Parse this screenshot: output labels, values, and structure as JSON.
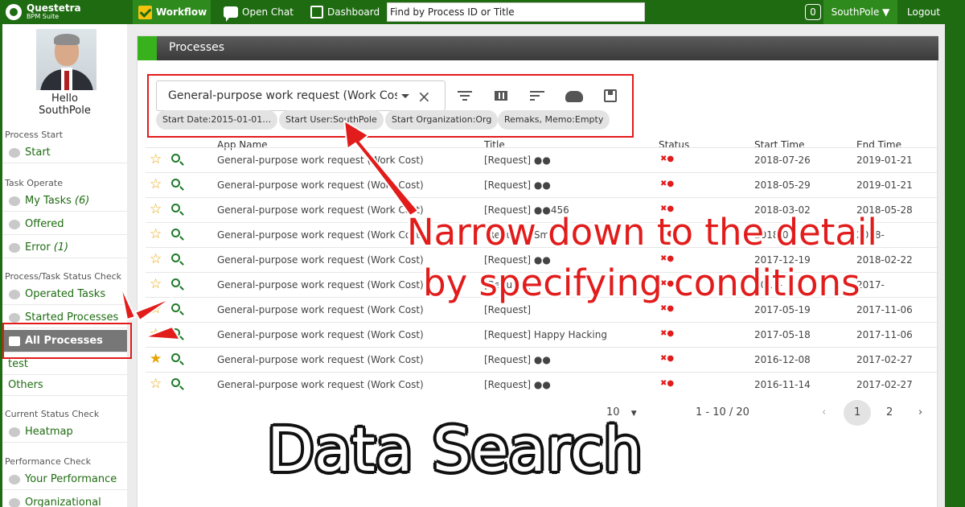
{
  "brand": {
    "name": "Questetra",
    "sub": "BPM Suite"
  },
  "topbar": {
    "workflow_label": "Workflow",
    "chat_label": "Open Chat",
    "dashboard_label": "Dashboard",
    "search_placeholder": "Find by Process ID or Title",
    "notification_count": "0",
    "user_label": "SouthPole ▼",
    "logout_label": "Logout"
  },
  "sidebar": {
    "hello": "Hello",
    "user": "SouthPole",
    "section_process_start": "Process Start",
    "start": "Start",
    "section_task_operate": "Task Operate",
    "my_tasks": "My Tasks",
    "my_tasks_count": "(6)",
    "offered": "Offered",
    "error": "Error",
    "error_count": "(1)",
    "section_status_check": "Process/Task Status Check",
    "operated_tasks": "Operated Tasks",
    "started_processes": "Started Processes",
    "all_processes": "All Processes",
    "test": "test",
    "others": "Others",
    "section_current_status": "Current Status Check",
    "heatmap": "Heatmap",
    "section_performance": "Performance Check",
    "your_performance": "Your Performance",
    "organizational": "Organizational"
  },
  "panel": {
    "title": "Processes",
    "filter_select": "General-purpose work request (Work Cost)",
    "chips": [
      "Start Date:2015-01-01…",
      "Start User:SouthPole",
      "Start Organization:Org",
      "Remaks, Memo:Empty"
    ]
  },
  "table": {
    "headers": [
      "App Name",
      "Title",
      "Status",
      "Start Time",
      "End Time"
    ],
    "rows": [
      {
        "app": "General-purpose work request (Work Cost)",
        "title": "[Request] ●●",
        "start": "2018-07-26",
        "end": "2019-01-21",
        "starred": false
      },
      {
        "app": "General-purpose work request (Work Cost)",
        "title": "[Request] ●●",
        "start": "2018-05-29",
        "end": "2019-01-21",
        "starred": false
      },
      {
        "app": "General-purpose work request (Work Cost)",
        "title": "[Request] ●●456",
        "start": "2018-03-02",
        "end": "2018-05-28",
        "starred": false
      },
      {
        "app": "General-purpose work request (Work Cost)",
        "title": "[Request] Sm",
        "start": "2018-01-",
        "end": "2018-",
        "starred": false
      },
      {
        "app": "General-purpose work request (Work Cost)",
        "title": "[Request] ●●",
        "start": "2017-12-19",
        "end": "2018-02-22",
        "starred": false
      },
      {
        "app": "General-purpose work request (Work Cost)",
        "title": "[Request]",
        "start": "2017-",
        "end": "2017-",
        "starred": false
      },
      {
        "app": "General-purpose work request (Work Cost)",
        "title": "[Request]",
        "start": "2017-05-19",
        "end": "2017-11-06",
        "starred": false
      },
      {
        "app": "General-purpose work request (Work Cost)",
        "title": "[Request] Happy Hacking",
        "start": "2017-05-18",
        "end": "2017-11-06",
        "starred": false
      },
      {
        "app": "General-purpose work request (Work Cost)",
        "title": "[Request] ●●",
        "start": "2016-12-08",
        "end": "2017-02-27",
        "starred": true
      },
      {
        "app": "General-purpose work request (Work Cost)",
        "title": "[Request] ●●",
        "start": "2016-11-14",
        "end": "2017-02-27",
        "starred": false
      }
    ]
  },
  "pagination": {
    "per_page": "10",
    "range": "1 - 10 / 20",
    "prev": "‹",
    "page1": "1",
    "page2": "2",
    "next": "›"
  },
  "overlay": {
    "caption_line1": "Narrow down to the detail",
    "caption_line2": "by  specifying conditions",
    "title": "Data Search"
  },
  "colors": {
    "brand_green": "#1f6b12",
    "accent_red": "#e21b1b",
    "star": "#e8a400"
  }
}
